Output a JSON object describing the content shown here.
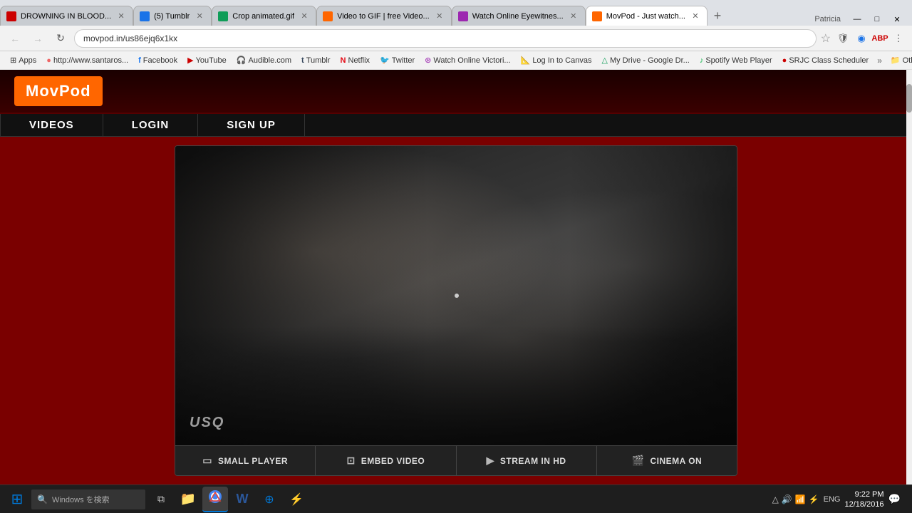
{
  "window": {
    "title": "MovPod - Just watch...",
    "controls": {
      "minimize": "—",
      "maximize": "□",
      "close": "✕"
    }
  },
  "tabs": [
    {
      "id": "tab1",
      "label": "DROWNING IN BLOOD...",
      "active": false,
      "fav_color": "fav-red"
    },
    {
      "id": "tab2",
      "label": "(5) Tumblr",
      "active": false,
      "fav_color": "fav-blue"
    },
    {
      "id": "tab3",
      "label": "Crop animated.gif",
      "active": false,
      "fav_color": "fav-green"
    },
    {
      "id": "tab4",
      "label": "Video to GIF | free Video...",
      "active": false,
      "fav_color": "fav-orange"
    },
    {
      "id": "tab5",
      "label": "Watch Online Eyewitnes...",
      "active": false,
      "fav_color": "fav-purple"
    },
    {
      "id": "tab6",
      "label": "MovPod - Just watch...",
      "active": true,
      "fav_color": "fav-orange"
    }
  ],
  "toolbar": {
    "url": "movpod.in/us86ejq6x1kx",
    "star": "☆",
    "back": "←",
    "forward": "→",
    "refresh": "↻",
    "home": "⌂"
  },
  "bookmarks": [
    {
      "label": "Apps",
      "icon": "⊞"
    },
    {
      "label": "http://www.santaros...",
      "icon": "🔗"
    },
    {
      "label": "Facebook",
      "icon": "f"
    },
    {
      "label": "YouTube",
      "icon": "▶"
    },
    {
      "label": "Audible.com",
      "icon": "🎧"
    },
    {
      "label": "Tumblr",
      "icon": "t"
    },
    {
      "label": "Netflix",
      "icon": "N"
    },
    {
      "label": "Twitter",
      "icon": "🐦"
    },
    {
      "label": "Watch Online Victori...",
      "icon": "📺"
    },
    {
      "label": "Log In to Canvas",
      "icon": "📐"
    },
    {
      "label": "My Drive - Google Dr...",
      "icon": "△"
    },
    {
      "label": "Spotify Web Player",
      "icon": "♪"
    },
    {
      "label": "SRJC Class Scheduler",
      "icon": "📅"
    },
    {
      "label": "»",
      "icon": ""
    },
    {
      "label": "Other bookmarks",
      "icon": "📁"
    }
  ],
  "site": {
    "logo": "MovPod",
    "nav": [
      {
        "label": "VIDEOS"
      },
      {
        "label": "LOGIN"
      },
      {
        "label": "SIGN UP"
      }
    ]
  },
  "video": {
    "watermark": "USQ",
    "cursor_visible": true
  },
  "player_controls": [
    {
      "id": "small-player",
      "icon": "▭",
      "label": "SMALL PLAYER"
    },
    {
      "id": "embed-video",
      "icon": "⊞",
      "label": "EMBED VIDEO"
    },
    {
      "id": "stream-hd",
      "icon": "▶",
      "label": "STREAM IN HD"
    },
    {
      "id": "cinema-on",
      "icon": "🎬",
      "label": "CINEMA ON"
    }
  ],
  "taskbar": {
    "start_icon": "⊞",
    "search_text": "Windows を検索",
    "icons": [
      {
        "id": "task-view",
        "symbol": "⧉"
      },
      {
        "id": "file-explorer",
        "symbol": "📁"
      },
      {
        "id": "chrome",
        "symbol": "◉"
      },
      {
        "id": "word",
        "symbol": "W"
      },
      {
        "id": "app1",
        "symbol": "⊕"
      },
      {
        "id": "app2",
        "symbol": "⚡"
      }
    ],
    "tray": {
      "icons": [
        "△",
        "🔊",
        "📶",
        "⚡"
      ],
      "time": "9:22 PM",
      "date": "12/18/2016",
      "lang": "ENG"
    }
  },
  "user": {
    "name": "Patricia"
  }
}
